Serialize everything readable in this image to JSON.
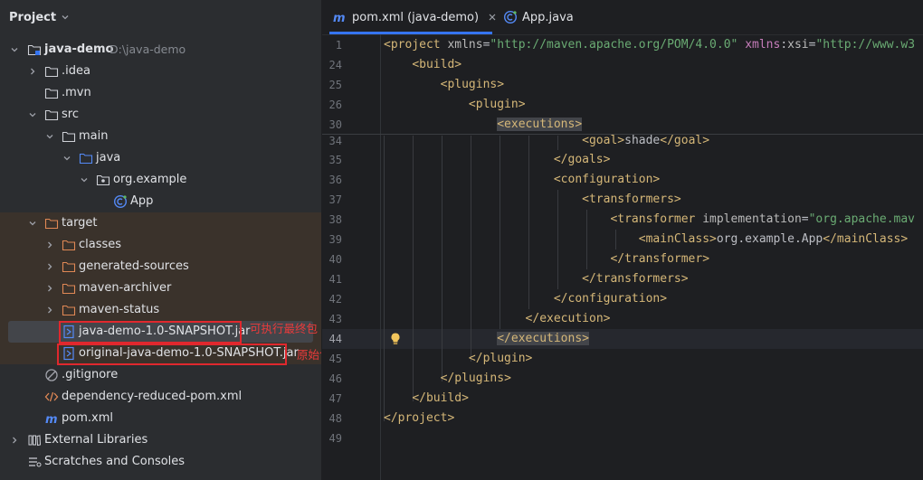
{
  "project_panel": {
    "title": "Project",
    "tree": [
      {
        "label": "java-demo",
        "note": "D:\\java-demo",
        "icon": "module-folder-icon"
      },
      {
        "label": ".idea",
        "icon": "folder-icon"
      },
      {
        "label": ".mvn",
        "icon": "folder-icon"
      },
      {
        "label": "src",
        "icon": "folder-icon"
      },
      {
        "label": "main",
        "icon": "folder-icon"
      },
      {
        "label": "java",
        "icon": "source-folder-icon"
      },
      {
        "label": "org.example",
        "icon": "package-icon"
      },
      {
        "label": "App",
        "icon": "java-class-icon"
      },
      {
        "label": "target",
        "icon": "excluded-folder-icon"
      },
      {
        "label": "classes",
        "icon": "excluded-folder-icon"
      },
      {
        "label": "generated-sources",
        "icon": "excluded-folder-icon"
      },
      {
        "label": "maven-archiver",
        "icon": "excluded-folder-icon"
      },
      {
        "label": "maven-status",
        "icon": "excluded-folder-icon"
      },
      {
        "label": "java-demo-1.0-SNAPSHOT.jar",
        "icon": "jar-file-icon"
      },
      {
        "label": "original-java-demo-1.0-SNAPSHOT.jar",
        "icon": "jar-file-icon"
      },
      {
        "label": ".gitignore",
        "icon": "gitignore-icon"
      },
      {
        "label": "dependency-reduced-pom.xml",
        "icon": "xml-file-icon"
      },
      {
        "label": "pom.xml",
        "icon": "maven-icon"
      },
      {
        "label": "External Libraries",
        "icon": "libraries-icon"
      },
      {
        "label": "Scratches and Consoles",
        "icon": "scratches-icon"
      }
    ],
    "annotations": {
      "executable_jar": "可执行最终包",
      "original_jar": "原始包(备份)"
    }
  },
  "editor": {
    "tabs": [
      {
        "label": "pom.xml (java-demo)",
        "icon": "maven-icon",
        "active": true
      },
      {
        "label": "App.java",
        "icon": "java-class-icon",
        "active": false
      }
    ],
    "line_numbers": [
      "1",
      "24",
      "25",
      "26",
      "30",
      "34",
      "35",
      "36",
      "37",
      "38",
      "39",
      "40",
      "41",
      "42",
      "43",
      "44",
      "45",
      "46",
      "47",
      "48",
      "49"
    ],
    "current_line": "44"
  },
  "colors": {
    "accent": "#3574f0",
    "annotation_red": "#e0282e",
    "xml_tag": "#d5b778",
    "xml_string": "#6aab73",
    "xml_namespace": "#c77dbb"
  }
}
